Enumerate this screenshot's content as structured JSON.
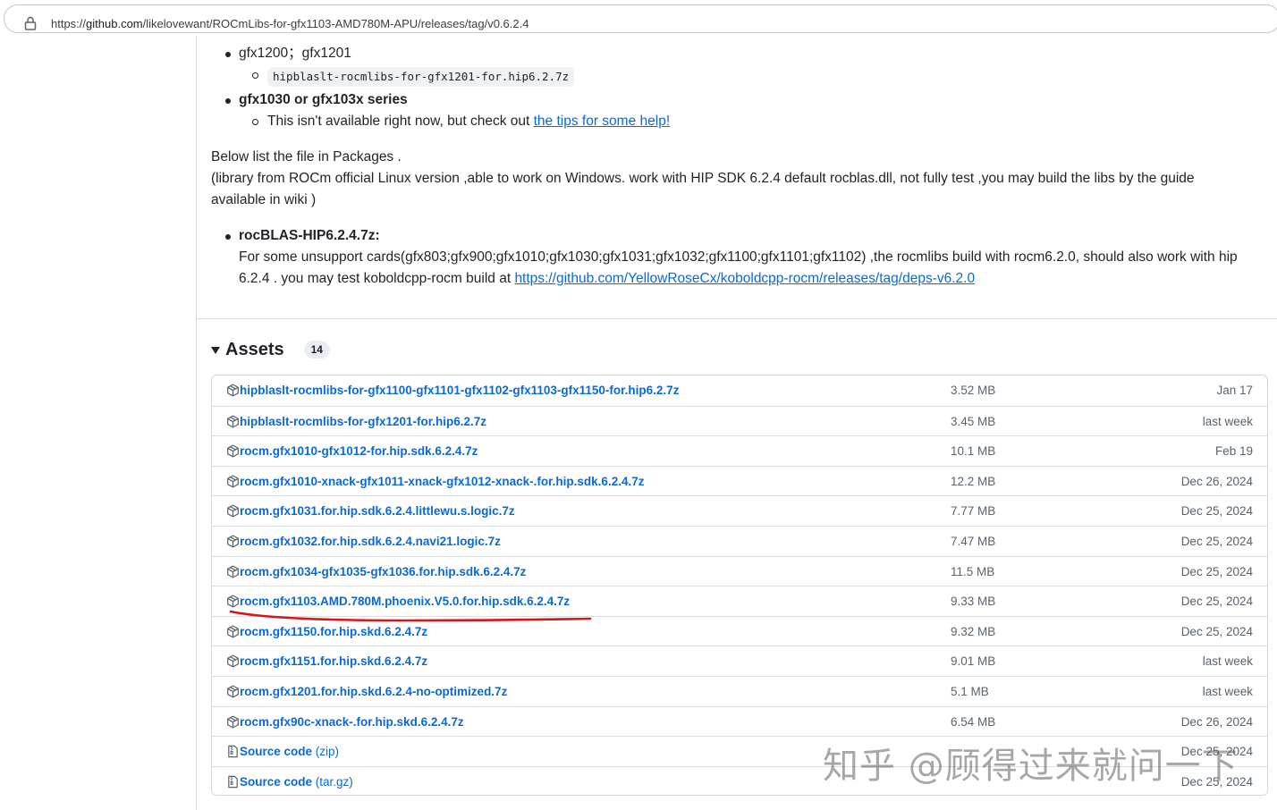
{
  "browser": {
    "url_prefix": "https://",
    "url_host": "github.com",
    "url_path": "/likelovewant/ROCmLibs-for-gfx1103-AMD780M-APU/releases/tag/v0.6.2.4"
  },
  "release_notes": {
    "item_gfx1200": "gfx1200；gfx1201",
    "item_gfx1200_file": "hipblaslt-rocmlibs-for-gfx1201-for.hip6.2.7z",
    "item_gfx1030": "gfx1030 or gfx103x series",
    "item_gfx1030_text": "This isn't available right now, but check out ",
    "item_gfx1030_link": "the tips for some help!",
    "packages_line1": "Below list the file in Packages .",
    "packages_line2": "(library from ROCm official Linux version ,able to work on Windows. work with HIP SDK 6.2.4 default rocblas.dll, not fully test ,you may build the libs by the guide",
    "packages_line3": "available in wiki )",
    "rocblas_title": "rocBLAS-HIP6.2.4.7z:",
    "rocblas_text1": "For some unsupport cards(gfx803;gfx900;gfx1010;gfx1030;gfx1031;gfx1032;gfx1100;gfx1101;gfx1102) ,the rocmlibs build with rocm6.2.0, should also work with hip",
    "rocblas_text2": "6.2.4 . you may test koboldcpp-rocm build at ",
    "rocblas_link": "https://github.com/YellowRoseCx/koboldcpp-rocm/releases/tag/deps-v6.2.0"
  },
  "assets": {
    "title": "Assets",
    "count": "14",
    "rows": [
      {
        "name": "hipblaslt-rocmlibs-for-gfx1100-gfx1101-gfx1102-gfx1103-gfx1150-for.hip6.2.7z",
        "suffix": "",
        "size": "3.52 MB",
        "date": "Jan 17",
        "icon": "package-icon"
      },
      {
        "name": "hipblaslt-rocmlibs-for-gfx1201-for.hip6.2.7z",
        "suffix": "",
        "size": "3.45 MB",
        "date": "last week",
        "icon": "package-icon"
      },
      {
        "name": "rocm.gfx1010-gfx1012-for.hip.sdk.6.2.4.7z",
        "suffix": "",
        "size": "10.1 MB",
        "date": "Feb 19",
        "icon": "package-icon"
      },
      {
        "name": "rocm.gfx1010-xnack-gfx1011-xnack-gfx1012-xnack-.for.hip.sdk.6.2.4.7z",
        "suffix": "",
        "size": "12.2 MB",
        "date": "Dec 26, 2024",
        "icon": "package-icon"
      },
      {
        "name": "rocm.gfx1031.for.hip.sdk.6.2.4.littlewu.s.logic.7z",
        "suffix": "",
        "size": "7.77 MB",
        "date": "Dec 25, 2024",
        "icon": "package-icon"
      },
      {
        "name": "rocm.gfx1032.for.hip.sdk.6.2.4.navi21.logic.7z",
        "suffix": "",
        "size": "7.47 MB",
        "date": "Dec 25, 2024",
        "icon": "package-icon"
      },
      {
        "name": "rocm.gfx1034-gfx1035-gfx1036.for.hip.sdk.6.2.4.7z",
        "suffix": "",
        "size": "11.5 MB",
        "date": "Dec 25, 2024",
        "icon": "package-icon"
      },
      {
        "name": "rocm.gfx1103.AMD.780M.phoenix.V5.0.for.hip.sdk.6.2.4.7z",
        "suffix": "",
        "size": "9.33 MB",
        "date": "Dec 25, 2024",
        "icon": "package-icon"
      },
      {
        "name": "rocm.gfx1150.for.hip.skd.6.2.4.7z",
        "suffix": "",
        "size": "9.32 MB",
        "date": "Dec 25, 2024",
        "icon": "package-icon"
      },
      {
        "name": "rocm.gfx1151.for.hip.skd.6.2.4.7z",
        "suffix": "",
        "size": "9.01 MB",
        "date": "last week",
        "icon": "package-icon"
      },
      {
        "name": "rocm.gfx1201.for.hip.skd.6.2.4-no-optimized.7z",
        "suffix": "",
        "size": "5.1 MB",
        "date": "last week",
        "icon": "package-icon"
      },
      {
        "name": "rocm.gfx90c-xnack-.for.hip.skd.6.2.4.7z",
        "suffix": "",
        "size": "6.54 MB",
        "date": "Dec 26, 2024",
        "icon": "package-icon"
      },
      {
        "name": "Source code",
        "suffix": " (zip)",
        "size": "",
        "date": "Dec 25, 2024",
        "icon": "file-zip-icon"
      },
      {
        "name": "Source code",
        "suffix": " (tar.gz)",
        "size": "",
        "date": "Dec 25, 2024",
        "icon": "file-zip-icon"
      }
    ]
  },
  "watermark": "知乎 @顾得过来就问一下",
  "colors": {
    "link": "#0969da",
    "muted": "#59636e",
    "annotation": "#d9141a"
  }
}
